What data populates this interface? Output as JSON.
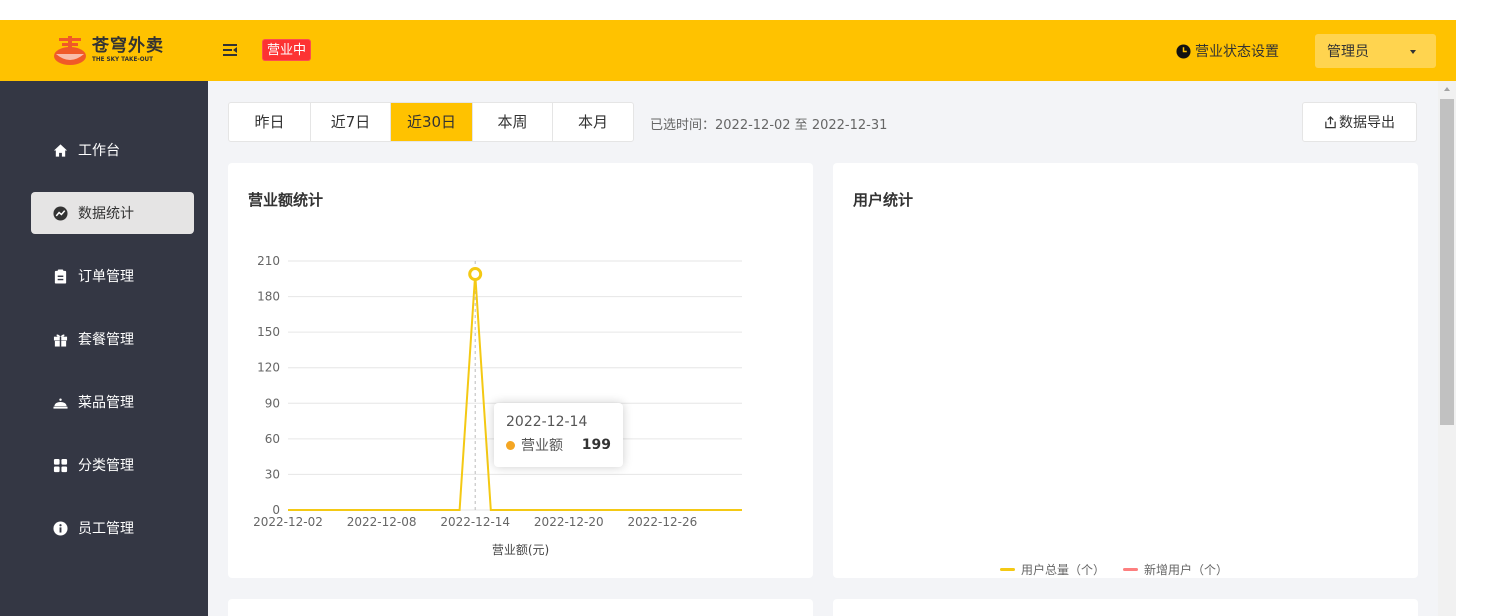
{
  "app": {
    "logo_title": "苍穹外卖",
    "logo_subtitle": "THE SKY TAKE-OUT",
    "status_badge": "营业中",
    "biz_setting": "营业状态设置",
    "admin": "管理员"
  },
  "sidebar": {
    "items": [
      {
        "label": "工作台",
        "icon": "home-icon"
      },
      {
        "label": "数据统计",
        "icon": "chart-icon",
        "active": true
      },
      {
        "label": "订单管理",
        "icon": "clipboard-icon"
      },
      {
        "label": "套餐管理",
        "icon": "gift-icon"
      },
      {
        "label": "菜品管理",
        "icon": "dish-cover-icon"
      },
      {
        "label": "分类管理",
        "icon": "grid-icon"
      },
      {
        "label": "员工管理",
        "icon": "info-icon"
      }
    ]
  },
  "toolbar": {
    "range_tabs": [
      "昨日",
      "近7日",
      "近30日",
      "本周",
      "本月"
    ],
    "active_tab": "近30日",
    "selected_time": "已选时间：2022-12-02 至 2022-12-31",
    "export_label": "数据导出"
  },
  "revenue_card": {
    "title": "营业额统计",
    "legend_label": "营业额(元)",
    "tooltip": {
      "date": "2022-12-14",
      "series": "营业额",
      "value": "199"
    }
  },
  "user_card": {
    "title": "用户统计",
    "legend": [
      "用户总量（个）",
      "新增用户（个）"
    ]
  },
  "colors": {
    "accent": "#ffc200",
    "sidebar_bg": "#343744",
    "badge_red": "#fd3333",
    "line_yellow": "#f4c914",
    "legend_red": "#fd7f7f"
  },
  "chart_data": {
    "type": "line",
    "x": [
      "2022-12-02",
      "2022-12-03",
      "2022-12-04",
      "2022-12-05",
      "2022-12-06",
      "2022-12-07",
      "2022-12-08",
      "2022-12-09",
      "2022-12-10",
      "2022-12-11",
      "2022-12-12",
      "2022-12-13",
      "2022-12-14",
      "2022-12-15",
      "2022-12-16",
      "2022-12-17",
      "2022-12-18",
      "2022-12-19",
      "2022-12-20",
      "2022-12-21",
      "2022-12-22",
      "2022-12-23",
      "2022-12-24",
      "2022-12-25",
      "2022-12-26",
      "2022-12-27",
      "2022-12-28",
      "2022-12-29",
      "2022-12-30",
      "2022-12-31"
    ],
    "x_ticks": [
      "2022-12-02",
      "2022-12-08",
      "2022-12-14",
      "2022-12-20",
      "2022-12-26"
    ],
    "series": [
      {
        "name": "营业额",
        "values": [
          0,
          0,
          0,
          0,
          0,
          0,
          0,
          0,
          0,
          0,
          0,
          0,
          199,
          0,
          0,
          0,
          0,
          0,
          0,
          0,
          0,
          0,
          0,
          0,
          0,
          0,
          0,
          0,
          0,
          0
        ]
      }
    ],
    "y_ticks": [
      0,
      30,
      60,
      90,
      120,
      150,
      180,
      210
    ],
    "ylim": [
      0,
      210
    ],
    "title": "营业额统计",
    "xlabel": "营业额(元)",
    "ylabel": "",
    "grid": true,
    "highlight": {
      "x": "2022-12-14",
      "y": 199
    }
  }
}
